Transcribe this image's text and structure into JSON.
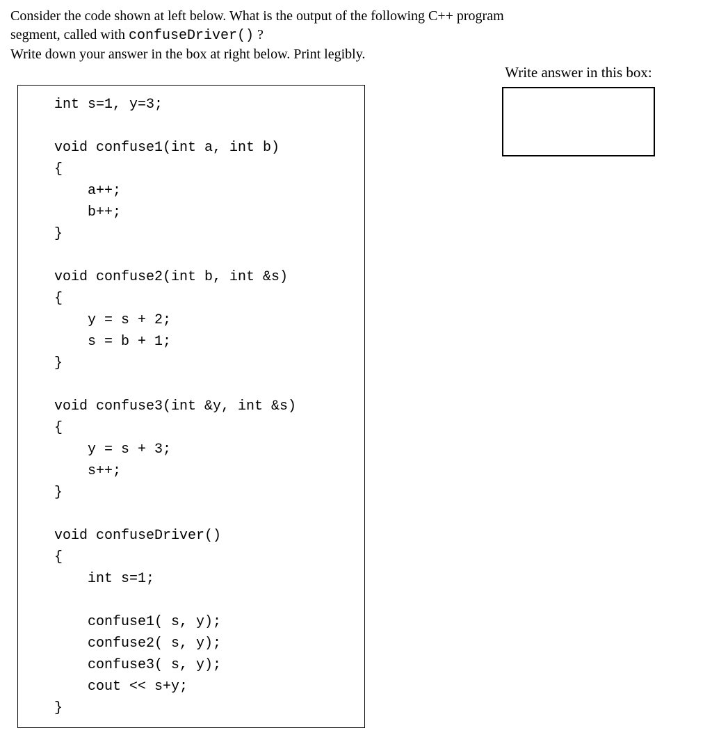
{
  "question": {
    "line1_part1": "Consider the code shown at left below.  What is the output of the following C++ program",
    "line2_part1": "segment, called with  ",
    "line2_code": "confuseDriver()",
    "line2_part2": " ?",
    "line3": "Write down your answer in the box at right below. Print legibly."
  },
  "answer_label": "Write answer in this box:",
  "code": "   int s=1, y=3;\n\n   void confuse1(int a, int b)\n   {\n       a++;\n       b++;\n   }\n\n   void confuse2(int b, int &s)\n   {\n       y = s + 2;\n       s = b + 1;\n   }\n\n   void confuse3(int &y, int &s)\n   {\n       y = s + 3;\n       s++;\n   }\n\n   void confuseDriver()\n   {\n       int s=1;\n\n       confuse1( s, y);\n       confuse2( s, y);\n       confuse3( s, y);\n       cout << s+y;\n   }"
}
